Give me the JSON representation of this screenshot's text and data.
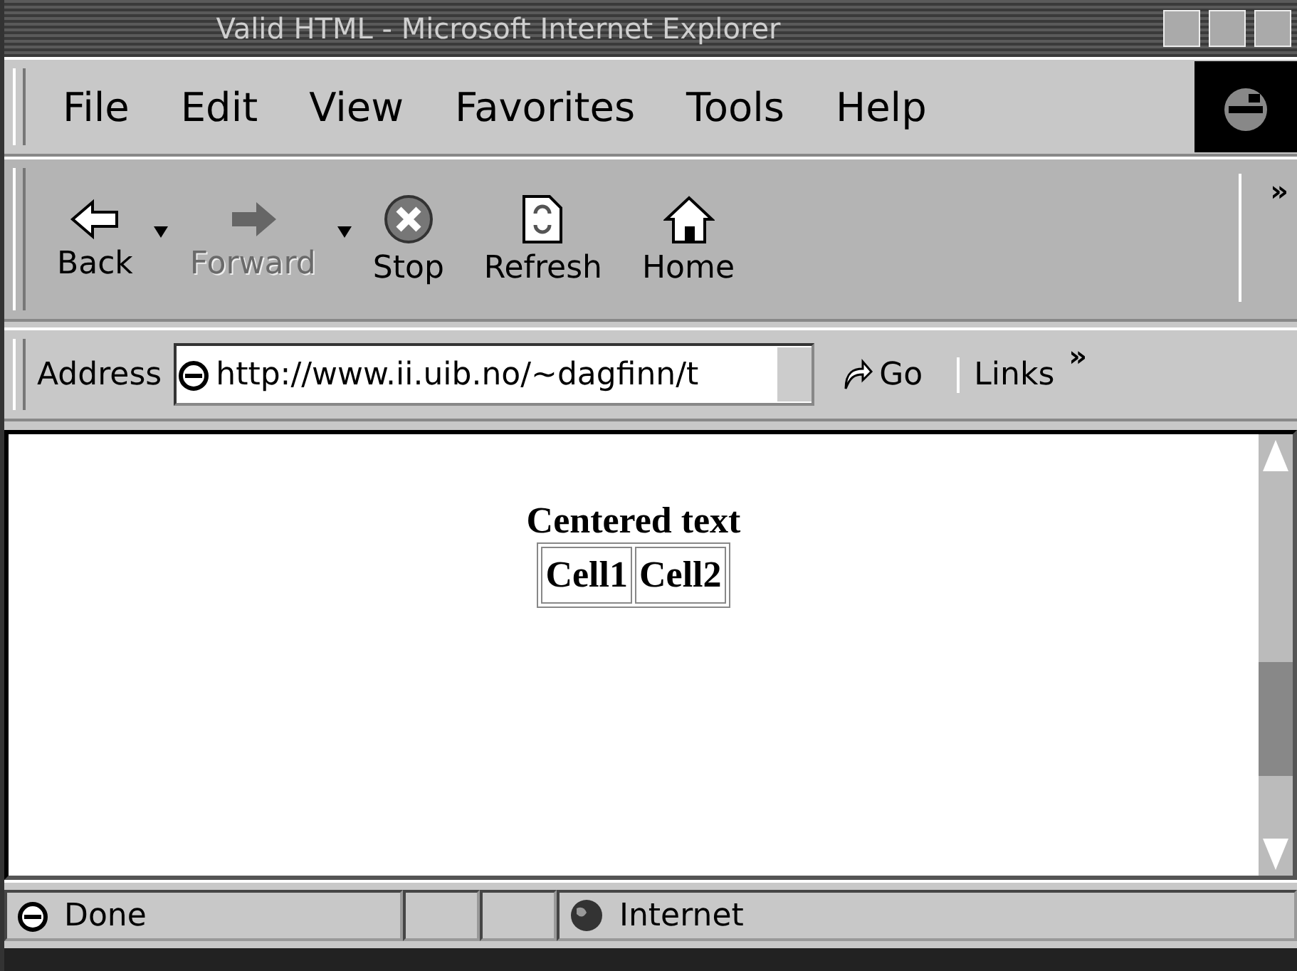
{
  "window": {
    "title": "Valid HTML - Microsoft Internet Explorer"
  },
  "menu": [
    "File",
    "Edit",
    "View",
    "Favorites",
    "Tools",
    "Help"
  ],
  "toolbar": [
    {
      "label": "Back",
      "kind": "back",
      "disabled": false,
      "dropdown": true
    },
    {
      "label": "Forward",
      "kind": "forward",
      "disabled": true,
      "dropdown": true
    },
    {
      "label": "Stop",
      "kind": "stop",
      "disabled": false,
      "dropdown": false
    },
    {
      "label": "Refresh",
      "kind": "refresh",
      "disabled": false,
      "dropdown": false
    },
    {
      "label": "Home",
      "kind": "home",
      "disabled": false,
      "dropdown": false
    }
  ],
  "toolbar_more": "»",
  "address_bar": {
    "label": "Address",
    "value": "http://www.ii.uib.no/~dagfinn/t",
    "go": "Go",
    "links": "Links",
    "links_more": "»"
  },
  "page": {
    "heading": "Centered text",
    "cells": [
      "Cell1",
      "Cell2"
    ]
  },
  "status_bar": {
    "status": "Done",
    "zone": "Internet"
  }
}
